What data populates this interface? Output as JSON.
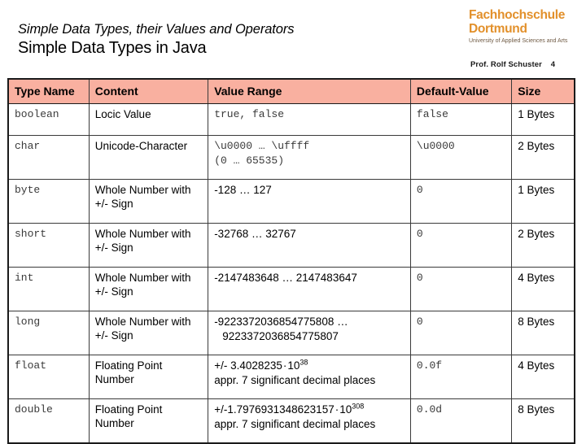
{
  "slide": {
    "subtitle": "Simple Data Types, their Values and Operators",
    "title": "Simple Data Types in Java",
    "presenter": "Prof. Rolf Schuster",
    "page_number": "4"
  },
  "logo": {
    "line1": "Fachhochschule",
    "line2": "Dortmund",
    "tagline": "University of Applied Sciences and Arts",
    "color": "#e2902b"
  },
  "table": {
    "header_bg": "#f9b0a0",
    "headers": [
      "Type Name",
      "Content",
      "Value Range",
      "Default-Value",
      "Size"
    ],
    "rows": [
      {
        "type_name": "boolean",
        "content": "Locic Value",
        "range_line1": "true, false",
        "range_line2": "",
        "range_mono": true,
        "default_value": "false",
        "size": "1 Bytes"
      },
      {
        "type_name": "char",
        "content": "Unicode-Character",
        "range_line1": "\\u0000 … \\uffff",
        "range_line2": "(0            … 65535)",
        "range_mono": true,
        "default_value": "\\u0000",
        "size": "2 Bytes"
      },
      {
        "type_name": "byte",
        "content": "Whole Number with +/- Sign",
        "range_line1": "-128 … 127",
        "range_line2": "",
        "range_mono": false,
        "default_value": "0",
        "size": "1 Bytes"
      },
      {
        "type_name": "short",
        "content": "Whole Number with +/- Sign",
        "range_line1": "-32768 … 32767",
        "range_line2": "",
        "range_mono": false,
        "default_value": "0",
        "size": "2 Bytes"
      },
      {
        "type_name": "int",
        "content": "Whole Number with +/- Sign",
        "range_line1": "-2147483648 … 2147483647",
        "range_line2": "",
        "range_mono": false,
        "default_value": "0",
        "size": "4 Bytes"
      },
      {
        "type_name": "long",
        "content": "Whole Number with +/- Sign",
        "range_line1": "-9223372036854775808 …",
        "range_line2": "9223372036854775807",
        "range_line2_indent": true,
        "range_mono": false,
        "default_value": "0",
        "size": "8 Bytes"
      },
      {
        "type_name": "float",
        "content": "Floating Point Number",
        "range_mantissa": "+/- 3.4028235",
        "range_base": "10",
        "range_exponent": "38",
        "range_line2": "appr. 7 significant decimal places",
        "range_mono": false,
        "default_value": "0.0f",
        "size": "4 Bytes"
      },
      {
        "type_name": "double",
        "content": "Floating Point Number",
        "range_mantissa": "+/-1.7976931348623157",
        "range_base": "10",
        "range_exponent": "308",
        "range_line2": "appr. 7 significant decimal places",
        "range_mono": false,
        "default_value": "0.0d",
        "size": "8 Bytes"
      }
    ]
  }
}
